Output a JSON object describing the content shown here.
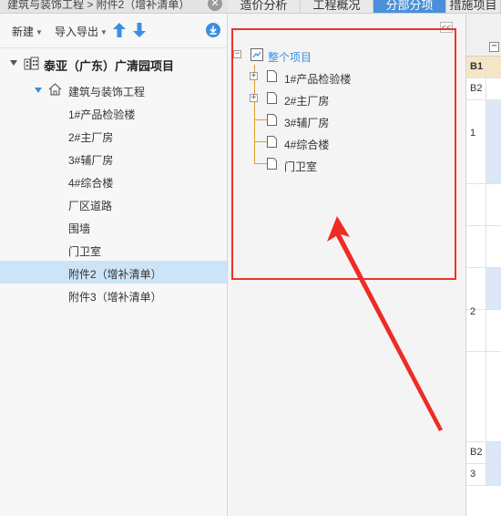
{
  "breadcrumb": {
    "text": "建筑与装饰工程 > 附件2（增补清单）",
    "close_icon": "close-circle-icon"
  },
  "toolbar": {
    "new_label": "新建",
    "io_label": "导入导出",
    "up_icon": "arrow-up-icon",
    "down_icon": "arrow-down-icon",
    "download_icon": "download-circle-icon",
    "accent_color": "#3c8fe0"
  },
  "project_tree": {
    "root_label": "泰亚（广东）广清园项目",
    "sub_label": "建筑与装饰工程",
    "items": [
      "1#产品检验楼",
      "2#主厂房",
      "3#辅厂房",
      "4#综合楼",
      "厂区道路",
      "围墙",
      "门卫室",
      "附件2（增补清单）",
      "附件3（增补清单）"
    ],
    "selected_item": "附件2（增补清单）",
    "selected_color": "#cce4f7"
  },
  "tabs": [
    "造价分析",
    "工程概况",
    "分部分项",
    "措施项目"
  ],
  "active_tab": "分部分项",
  "division_tree": {
    "collapse_label": "<<",
    "root_label": "整个项目",
    "nodes": [
      {
        "label": "1#产品检验楼",
        "expandable": true
      },
      {
        "label": "2#主厂房",
        "expandable": true
      },
      {
        "label": "3#辅厂房",
        "expandable": false
      },
      {
        "label": "4#综合楼",
        "expandable": false
      },
      {
        "label": "门卫室",
        "expandable": false
      }
    ]
  },
  "annotation": {
    "highlight_color": "#e8352c"
  },
  "grid": {
    "minus_label": "−",
    "rows": [
      {
        "num": "B1",
        "highlight": true
      },
      {
        "num": "B2",
        "highlight": false
      },
      {
        "num": "1",
        "highlight": false
      },
      {
        "num": "",
        "highlight": false
      },
      {
        "num": "",
        "highlight": false
      },
      {
        "num": "2",
        "highlight": false
      },
      {
        "num": "",
        "highlight": false
      },
      {
        "num": "",
        "highlight": false
      },
      {
        "num": "B2",
        "highlight": false
      },
      {
        "num": "3",
        "highlight": false
      }
    ]
  }
}
